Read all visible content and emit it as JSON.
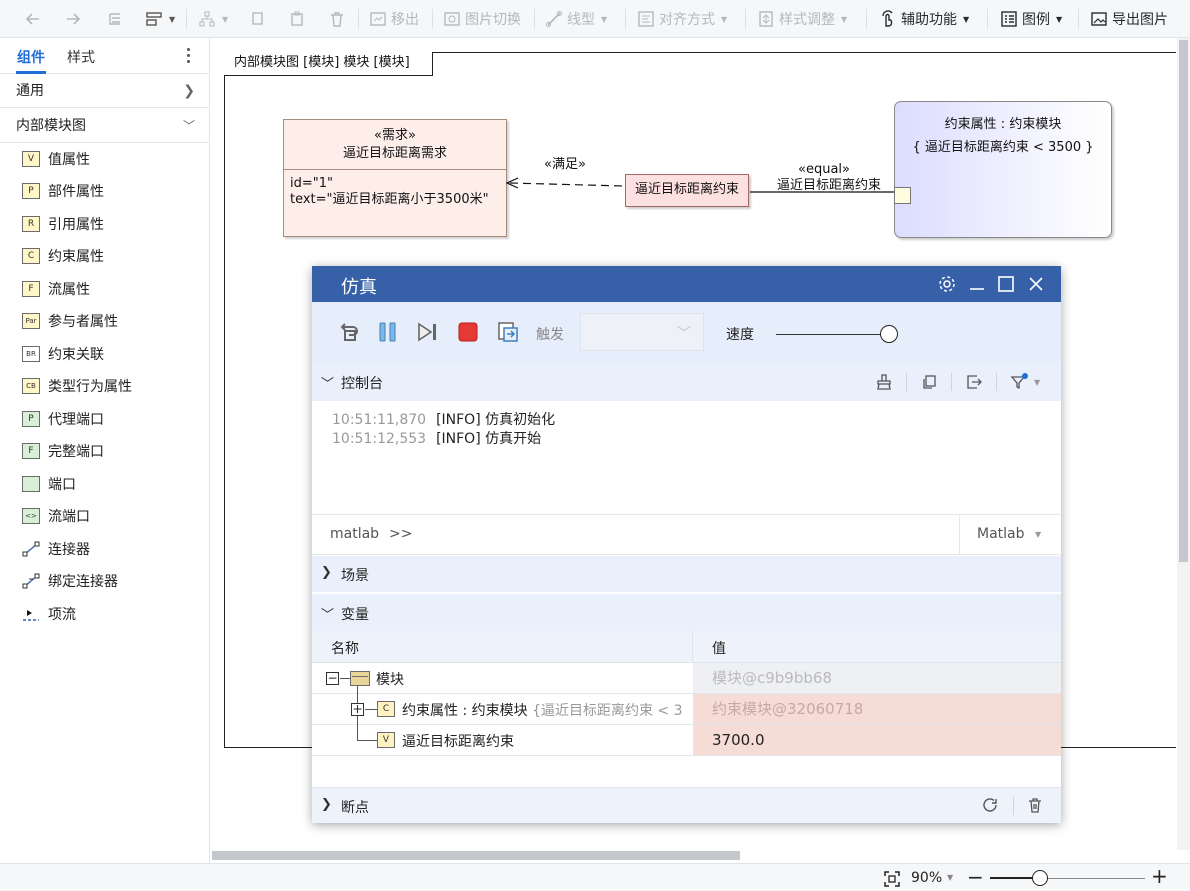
{
  "toolbar": {
    "move_out": "移出",
    "image_switch": "图片切换",
    "line_type": "线型",
    "align": "对齐方式",
    "style_adjust": "样式调整",
    "assist": "辅助功能",
    "legend": "图例",
    "export_image": "导出图片"
  },
  "sidebar": {
    "tabs": [
      "组件",
      "样式"
    ],
    "categories": [
      "通用",
      "内部模块图"
    ],
    "items": [
      {
        "icon": "V",
        "label": "值属性"
      },
      {
        "icon": "P",
        "label": "部件属性"
      },
      {
        "icon": "R",
        "label": "引用属性"
      },
      {
        "icon": "C",
        "label": "约束属性"
      },
      {
        "icon": "F",
        "label": "流属性"
      },
      {
        "icon": "Par",
        "label": "参与者属性"
      },
      {
        "icon": "BR",
        "label": "约束关联"
      },
      {
        "icon": "CB",
        "label": "类型行为属性"
      },
      {
        "icon": "P",
        "label": "代理端口"
      },
      {
        "icon": "F",
        "label": "完整端口"
      },
      {
        "icon": "",
        "label": "端口"
      },
      {
        "icon": "<>",
        "label": "流端口"
      },
      {
        "icon": "connector-icon",
        "label": "连接器"
      },
      {
        "icon": "binding-connector-icon",
        "label": "绑定连接器"
      },
      {
        "icon": "item-flow-icon",
        "label": "项流"
      }
    ]
  },
  "diagram": {
    "frame_label": "内部模块图 [模块] 模块 [模块]",
    "requirement": {
      "stereotype": "«需求»",
      "name": "逼近目标距离需求",
      "id_line": "id=\"1\"",
      "text_line": "text=\"逼近目标距离小于3500米\""
    },
    "satisfy_label": "«满足»",
    "constraint_block": "逼近目标距离约束",
    "equal_stereotype": "«equal»",
    "equal_name": "逼近目标距离约束",
    "constraint_property": {
      "title": "约束属性 : 约束模块",
      "expression": "{ 逼近目标距离约束 < 3500 }"
    }
  },
  "status_bar": {
    "zoom": "90%",
    "zoom_level": 0.3
  },
  "dialog": {
    "title": "仿真",
    "trigger_label": "触发",
    "trigger_value": "",
    "speed_label": "速度",
    "speed_level": 1.0,
    "console_title": "控制台",
    "log": [
      {
        "time": "10:51:11,870",
        "msg": "[INFO] 仿真初始化"
      },
      {
        "time": "10:51:12,553",
        "msg": "[INFO] 仿真开始"
      }
    ],
    "cmd_prefix": "matlab",
    "cmd_prompt": ">>",
    "cmd_language": "Matlab",
    "scene_title": "场景",
    "variables_title": "变量",
    "var_headers": [
      "名称",
      "值"
    ],
    "variables": [
      {
        "icon": "block-icon",
        "name": "模块",
        "ext": "",
        "value": "模块@c9b9bb68"
      },
      {
        "icon": "C",
        "name": "约束属性 : 约束模块",
        "ext": "{逼近目标距离约束 < 3",
        "value": "约束模块@32060718"
      },
      {
        "icon": "V",
        "name": "逼近目标距离约束",
        "ext": "",
        "value": "3700.0"
      }
    ],
    "breakpoints_title": "断点"
  },
  "colors": {
    "accent": "#1f6fd6",
    "dialog_header": "#3660a8",
    "tools_bg": "#e6eefb",
    "value_highlight": "#f6dcd7"
  }
}
